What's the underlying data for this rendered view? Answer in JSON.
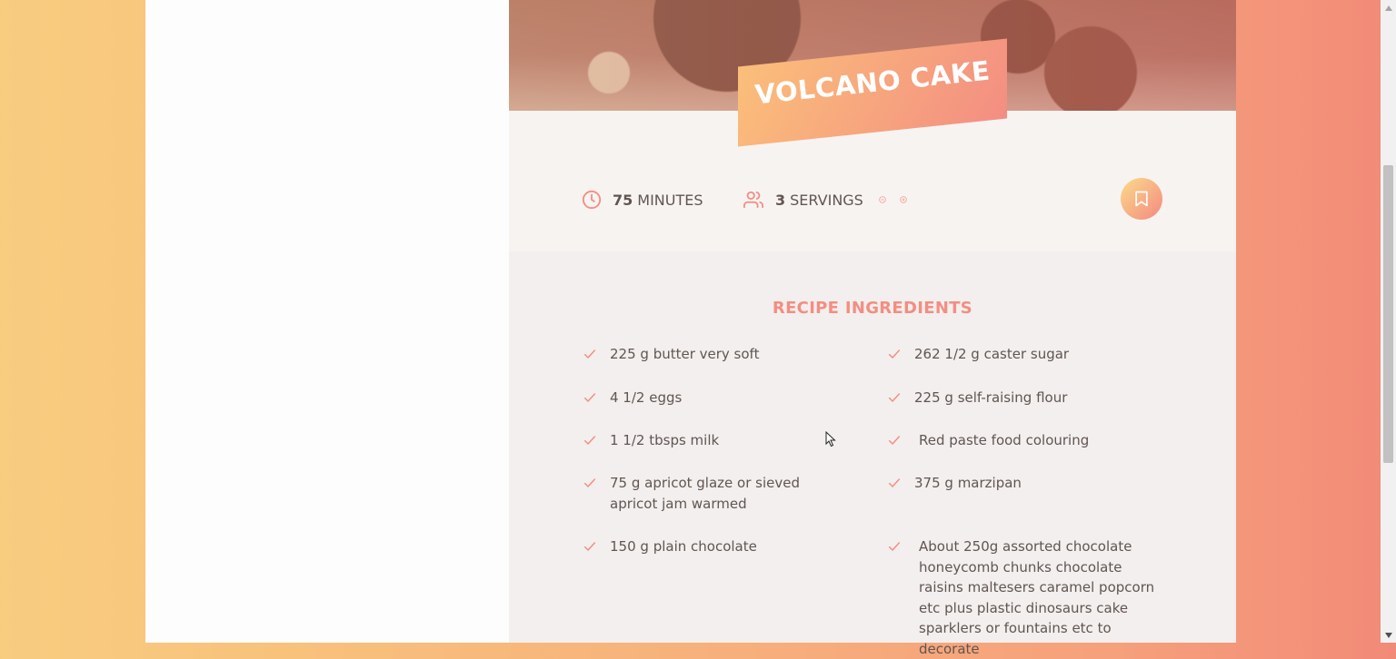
{
  "recipe": {
    "title": "VOLCANO CAKE",
    "cooking_time_value": "75",
    "cooking_time_unit": "MINUTES",
    "servings_value": "3",
    "servings_unit": "SERVINGS"
  },
  "ingredients": {
    "heading": "RECIPE INGREDIENTS",
    "left": [
      "225 g butter very soft",
      "4 1/2 eggs",
      "1 1/2 tbsps milk",
      "75 g apricot glaze or sieved apricot jam warmed",
      "150 g plain chocolate"
    ],
    "right": [
      "262 1/2 g caster sugar",
      "225 g self-raising flour",
      "Red paste food colouring",
      "375 g marzipan",
      "About 250g assorted chocolate honeycomb chunks chocolate raisins maltesers caramel popcorn etc plus plastic dinosaurs cake sparklers or fountains etc to decorate"
    ]
  },
  "icons": {
    "clock": "clock-icon",
    "users": "users-icon",
    "minus": "minus-circle-icon",
    "plus": "plus-circle-icon",
    "bookmark": "bookmark-icon",
    "check": "check-icon"
  },
  "colors": {
    "accent": "#f38e82",
    "gradient_start": "#fbdb89",
    "gradient_end": "#f48982",
    "text": "#615551"
  }
}
